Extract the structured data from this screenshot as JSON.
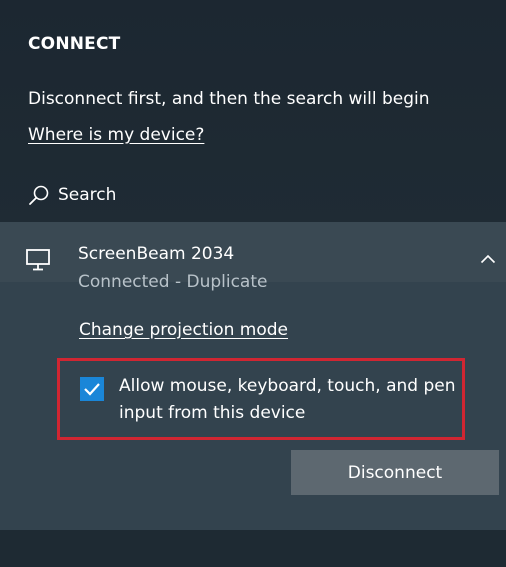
{
  "header": {
    "title": "CONNECT"
  },
  "info": {
    "text": "Disconnect first, and then the search will begin",
    "where_link": "Where is my device?"
  },
  "search": {
    "label": "Search",
    "icon": "search-icon"
  },
  "device": {
    "icon": "monitor-icon",
    "name": "ScreenBeam 2034",
    "status": "Connected - Duplicate",
    "expanded": true,
    "change_mode_link": "Change projection mode",
    "allow_input": {
      "checked": true,
      "label": "Allow mouse, keyboard, touch, and pen input from this device"
    },
    "disconnect_label": "Disconnect"
  },
  "colors": {
    "background": "#1f2a33",
    "card": "#33434e",
    "accent": "#1a86d8",
    "highlight_border": "#d12632",
    "button": "#5d6870"
  }
}
